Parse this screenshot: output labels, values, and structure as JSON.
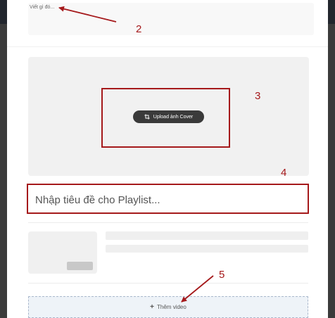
{
  "composer": {
    "placeholder": "Viết gì đó..."
  },
  "cover": {
    "upload_label": "Upload ảnh Cover",
    "icon": "crop-icon"
  },
  "playlist_title": {
    "placeholder": "Nhập tiêu đề cho Playlist..."
  },
  "add_video": {
    "label": "Thêm video",
    "icon": "plus-icon"
  },
  "annotations": {
    "n2": "2",
    "n3": "3",
    "n4": "4",
    "n5": "5",
    "color": "#a5191b"
  }
}
